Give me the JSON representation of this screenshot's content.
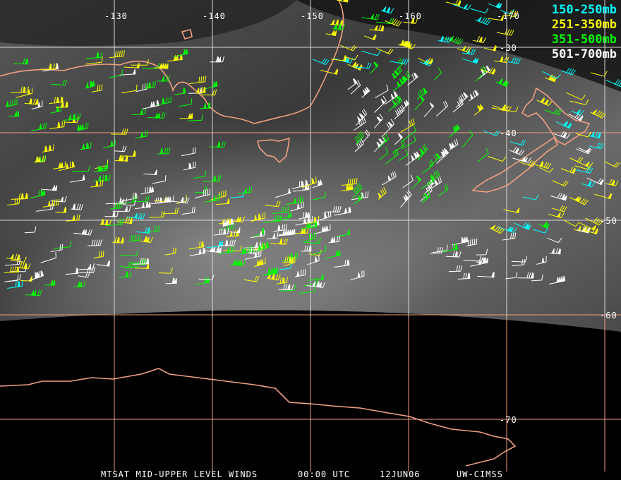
{
  "map": {
    "longitude_labels": [
      "-130",
      "-140",
      "-150",
      "-160",
      "-170"
    ],
    "latitude_labels": [
      "-30",
      "-40",
      "-50",
      "-60",
      "-70"
    ]
  },
  "legend": [
    {
      "label": "150-250mb",
      "color": "#00ffff"
    },
    {
      "label": "251-350mb",
      "color": "#ffff00"
    },
    {
      "label": "351-500mb",
      "color": "#00ff00"
    },
    {
      "label": "501-700mb",
      "color": "#ffffff"
    }
  ],
  "caption": {
    "product": "MTSAT MID-UPPER LEVEL WINDS",
    "time": "00:00 UTC",
    "date": "12JUN06",
    "source": "UW-CIMSS"
  },
  "colors": {
    "coastline": "#f0a080",
    "grid": "#f0a080",
    "grid_light": "#dddddd"
  }
}
